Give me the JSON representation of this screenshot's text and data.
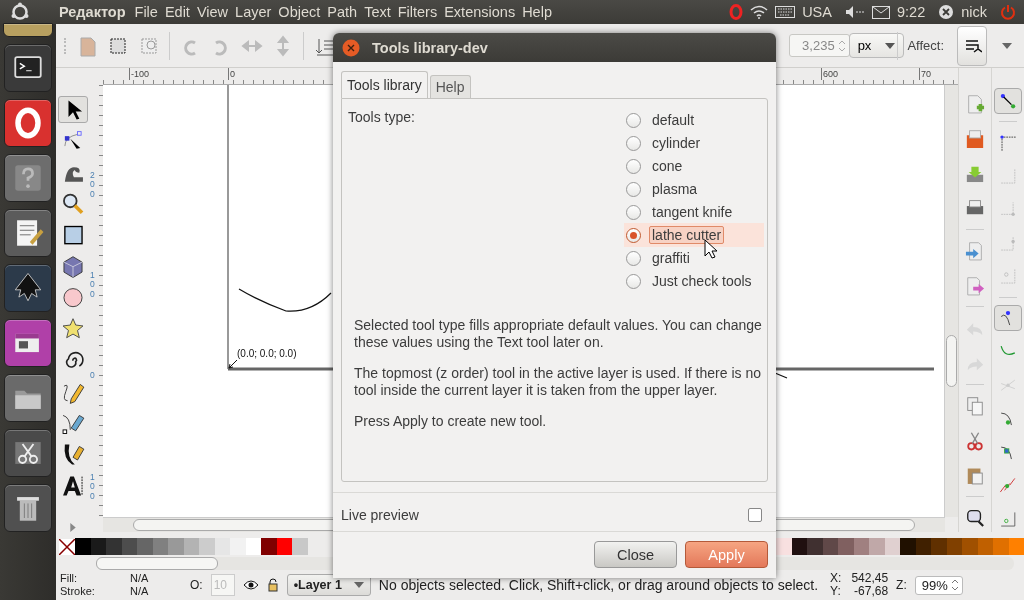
{
  "top_panel": {
    "app_name": "Редактор",
    "menus": [
      "File",
      "Edit",
      "View",
      "Layer",
      "Object",
      "Path",
      "Text",
      "Filters",
      "Extensions",
      "Help"
    ],
    "keyboard": "USA",
    "time": "9:22",
    "user": "nick"
  },
  "toolbar": {
    "value": "3,235",
    "unit": "px",
    "affect_label": "Affect:"
  },
  "rulers": {
    "horizontal": [
      "-100",
      "0",
      "600",
      "70"
    ],
    "vertical": [
      "200",
      "100",
      "0",
      "100"
    ]
  },
  "canvas": {
    "origin_label": "(0.0; 0.0; 0.0)"
  },
  "dialog": {
    "title": "Tools library-dev",
    "tabs": [
      {
        "label": "Tools library",
        "selected": true
      },
      {
        "label": "Help",
        "selected": false
      }
    ],
    "tools_type_label": "Tools type:",
    "options": [
      {
        "label": "default",
        "selected": false
      },
      {
        "label": "cylinder",
        "selected": false
      },
      {
        "label": "cone",
        "selected": false
      },
      {
        "label": "plasma",
        "selected": false
      },
      {
        "label": "tangent knife",
        "selected": false
      },
      {
        "label": "lathe cutter",
        "selected": true
      },
      {
        "label": "graffiti",
        "selected": false
      },
      {
        "label": "Just check tools",
        "selected": false
      }
    ],
    "paragraphs": [
      "Selected tool type fills appropriate default values. You can change these values using the Text tool later on.",
      "The topmost (z order) tool in the active layer is used. If there is no tool inside the current layer it is taken from the upper layer.",
      "Press Apply to create new tool."
    ],
    "live_preview": {
      "label": "Live preview",
      "checked": false
    },
    "buttons": [
      {
        "label": "Close",
        "kind": "normal"
      },
      {
        "label": "Apply",
        "kind": "default"
      }
    ]
  },
  "status_bar": {
    "fill_label": "Fill:",
    "fill_value": "N/A",
    "stroke_label": "Stroke:",
    "stroke_value": "N/A",
    "opacity_label": "O:",
    "opacity_value": "10",
    "layer": "•Layer 1",
    "message": "No objects selected. Click, Shift+click, or drag around objects to select.",
    "x_label": "X:",
    "x_value": "542,45",
    "y_label": "Y:",
    "y_value": "-67,68",
    "zoom_label": "Z:",
    "zoom_value": "99%"
  }
}
